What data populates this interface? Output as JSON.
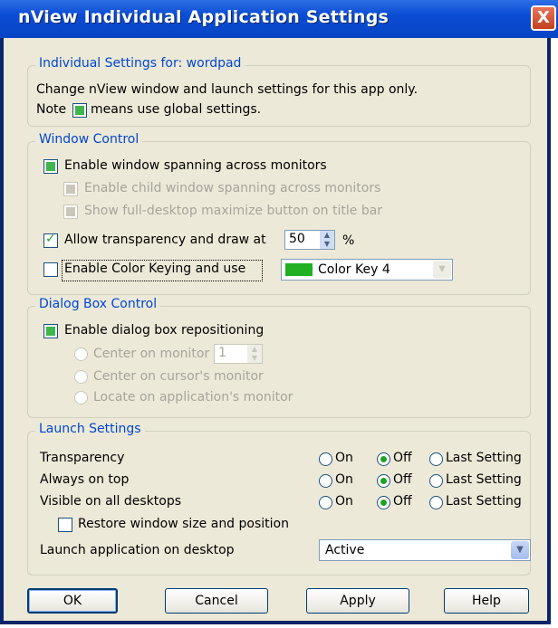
{
  "window": {
    "title": "nView Individual Application Settings",
    "close_glyph": "X"
  },
  "individual": {
    "group_title": "Individual Settings for: wordpad",
    "line1": "Change nView window and launch settings for this app only.",
    "note_prefix": "Note",
    "note_suffix": "means use global settings."
  },
  "window_control": {
    "group_title": "Window Control",
    "spanning": "Enable window spanning across monitors",
    "child_spanning": "Enable child window spanning across monitors",
    "full_desktop": "Show full-desktop maximize button on title bar",
    "transparency": "Allow transparency and draw at",
    "transparency_value": "50",
    "percent": "%",
    "color_keying": "Enable Color Keying and use",
    "color_key_selected": "Color Key 4",
    "color_key_swatch": "#21b021"
  },
  "dialog_box": {
    "group_title": "Dialog Box Control",
    "repositioning": "Enable dialog box repositioning",
    "center_monitor": "Center on monitor",
    "monitor_value": "1",
    "center_cursor": "Center on cursor's monitor",
    "locate_app": "Locate on application's monitor"
  },
  "launch": {
    "group_title": "Launch Settings",
    "rows": [
      {
        "label": "Transparency",
        "on": "On",
        "off": "Off",
        "last": "Last Setting",
        "selected": "off"
      },
      {
        "label": "Always on top",
        "on": "On",
        "off": "Off",
        "last": "Last Setting",
        "selected": "off"
      },
      {
        "label": "Visible on all desktops",
        "on": "On",
        "off": "Off",
        "last": "Last Setting",
        "selected": "off"
      }
    ],
    "restore": "Restore window size and position",
    "desktop_label": "Launch application on desktop",
    "desktop_value": "Active"
  },
  "buttons": {
    "ok": "OK",
    "cancel": "Cancel",
    "apply": "Apply",
    "help": "Help"
  },
  "colors": {
    "accent": "#0046d5",
    "titlebar": "#0845c6",
    "global_green": "#3fb54a",
    "face": "#ece9d8"
  }
}
